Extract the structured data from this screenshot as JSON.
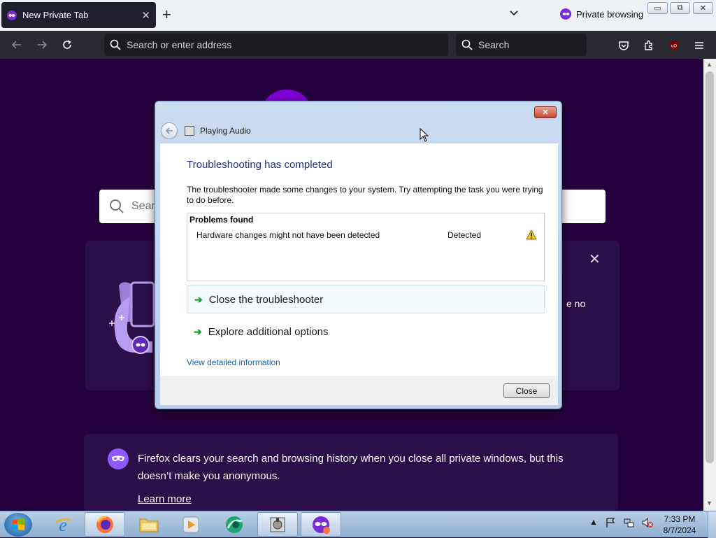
{
  "browser": {
    "tab_title": "New Private Tab",
    "tab_close": "✕",
    "new_tab": "+",
    "private_label": "Private browsing",
    "url_placeholder": "Search or enter address",
    "search_placeholder": "Search",
    "window_controls": {
      "minimize": "▭",
      "restore": "⧉",
      "close": "✕"
    }
  },
  "page": {
    "search_placeholder": "Search",
    "promo_fragment": "e no",
    "promo_close": "✕",
    "info_text": "Firefox clears your search and browsing history when you close all private windows, but this doesn’t make you anonymous.",
    "learn_more": "Learn more"
  },
  "dialog": {
    "header": "Playing Audio",
    "close_glyph": "✕",
    "title": "Troubleshooting has completed",
    "description": "The troubleshooter made some changes to your system. Try attempting the task you were trying to do before.",
    "problems_header": "Problems found",
    "problems": [
      {
        "name": "Hardware changes might not have been detected",
        "status": "Detected"
      }
    ],
    "actions": [
      {
        "label": "Close the troubleshooter"
      },
      {
        "label": "Explore additional options"
      }
    ],
    "view_details": "View detailed information",
    "close_button": "Close"
  },
  "taskbar": {
    "items": [
      "internet-explorer",
      "firefox",
      "file-explorer",
      "media-player",
      "browser-app",
      "disk-app",
      "firefox-private"
    ],
    "clock_time": "7:33 PM",
    "clock_date": "8/7/2024"
  },
  "colors": {
    "page_bg": "#25003e",
    "card_bg": "#2c0e49",
    "accent": "#8000d7",
    "dialog_title": "#1e3287",
    "link": "#1f5fb0"
  }
}
